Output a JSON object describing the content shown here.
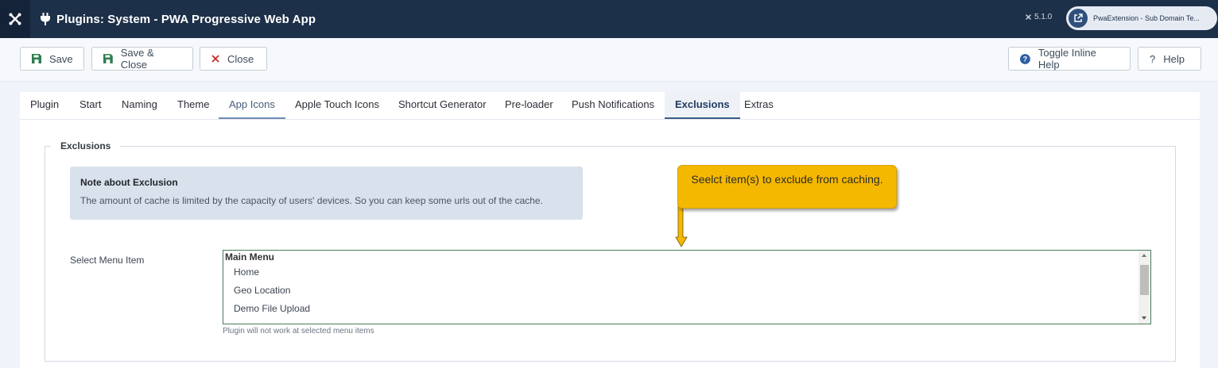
{
  "header": {
    "title": "Plugins: System - PWA Progressive Web App",
    "version": "5.1.0",
    "site_label": "PwaExtension - Sub Domain Te..."
  },
  "toolbar": {
    "save": "Save",
    "save_close": "Save & Close",
    "close": "Close",
    "toggle_help": "Toggle Inline Help",
    "help": "Help"
  },
  "tabs": [
    {
      "label": "Plugin"
    },
    {
      "label": "Start"
    },
    {
      "label": "Naming"
    },
    {
      "label": "Theme"
    },
    {
      "label": "App Icons"
    },
    {
      "label": "Apple Touch Icons"
    },
    {
      "label": "Shortcut Generator"
    },
    {
      "label": "Pre-loader"
    },
    {
      "label": "Push Notifications"
    },
    {
      "label": "Exclusions"
    },
    {
      "label": "Extras"
    }
  ],
  "active_tab": "Exclusions",
  "section": {
    "legend": "Exclusions",
    "note_title": "Note about Exclusion",
    "note_body": "The amount of cache is limited by the capacity of users' devices. So you can keep some urls out of the cache."
  },
  "field": {
    "label": "Select Menu Item",
    "group": "Main Menu",
    "options": [
      "Home",
      "Geo Location",
      "Demo File Upload"
    ],
    "hint": "Plugin will not work at selected menu items"
  },
  "callout": {
    "text": "Seelct item(s) to exclude from caching."
  },
  "colors": {
    "header_bg": "#1d3049",
    "save_icon": "#2e7d4f",
    "close_icon": "#c62828",
    "help_icon": "#2f5fa5",
    "callout": "#f5b800"
  }
}
